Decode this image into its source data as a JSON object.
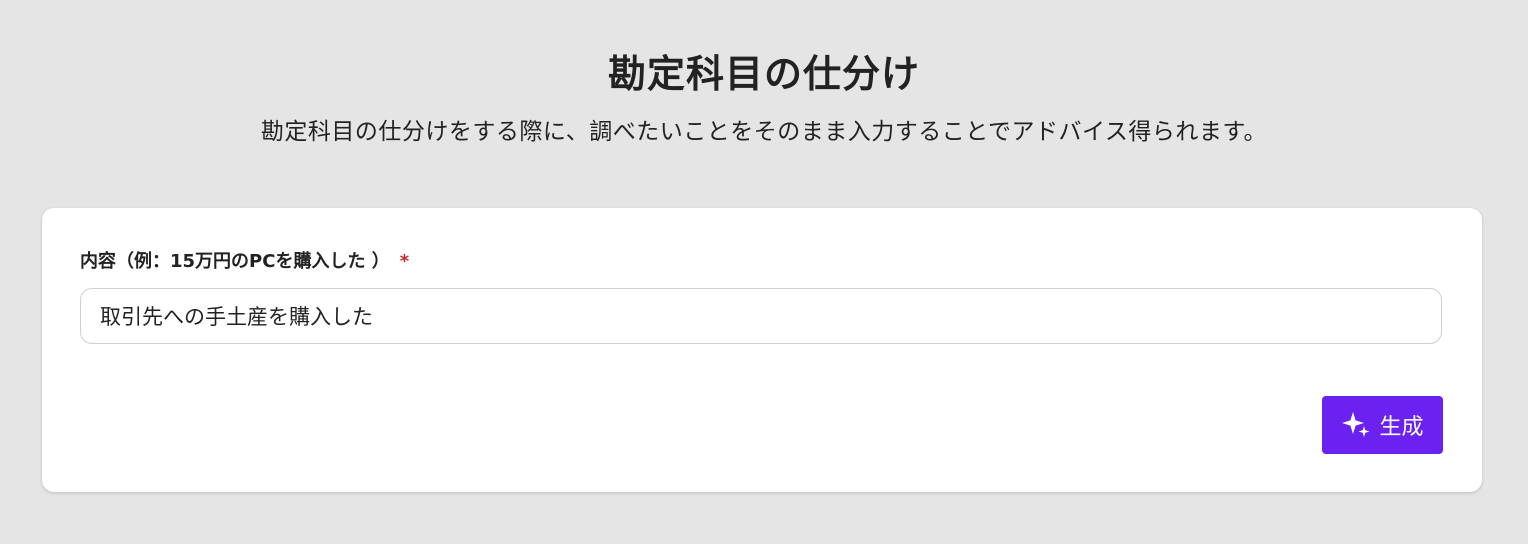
{
  "header": {
    "title": "勘定科目の仕分け",
    "subtitle": "勘定科目の仕分けをする際に、調べたいことをそのまま入力することでアドバイス得られます。"
  },
  "form": {
    "content_label": "内容（例：15万円のPCを購入した ）",
    "required_mark": "*",
    "content_value": "取引先への手土産を購入した",
    "generate_label": "生成",
    "generate_icon": "sparkle-icon",
    "accent_color": "#6b21f0",
    "required_color": "#c62828"
  }
}
